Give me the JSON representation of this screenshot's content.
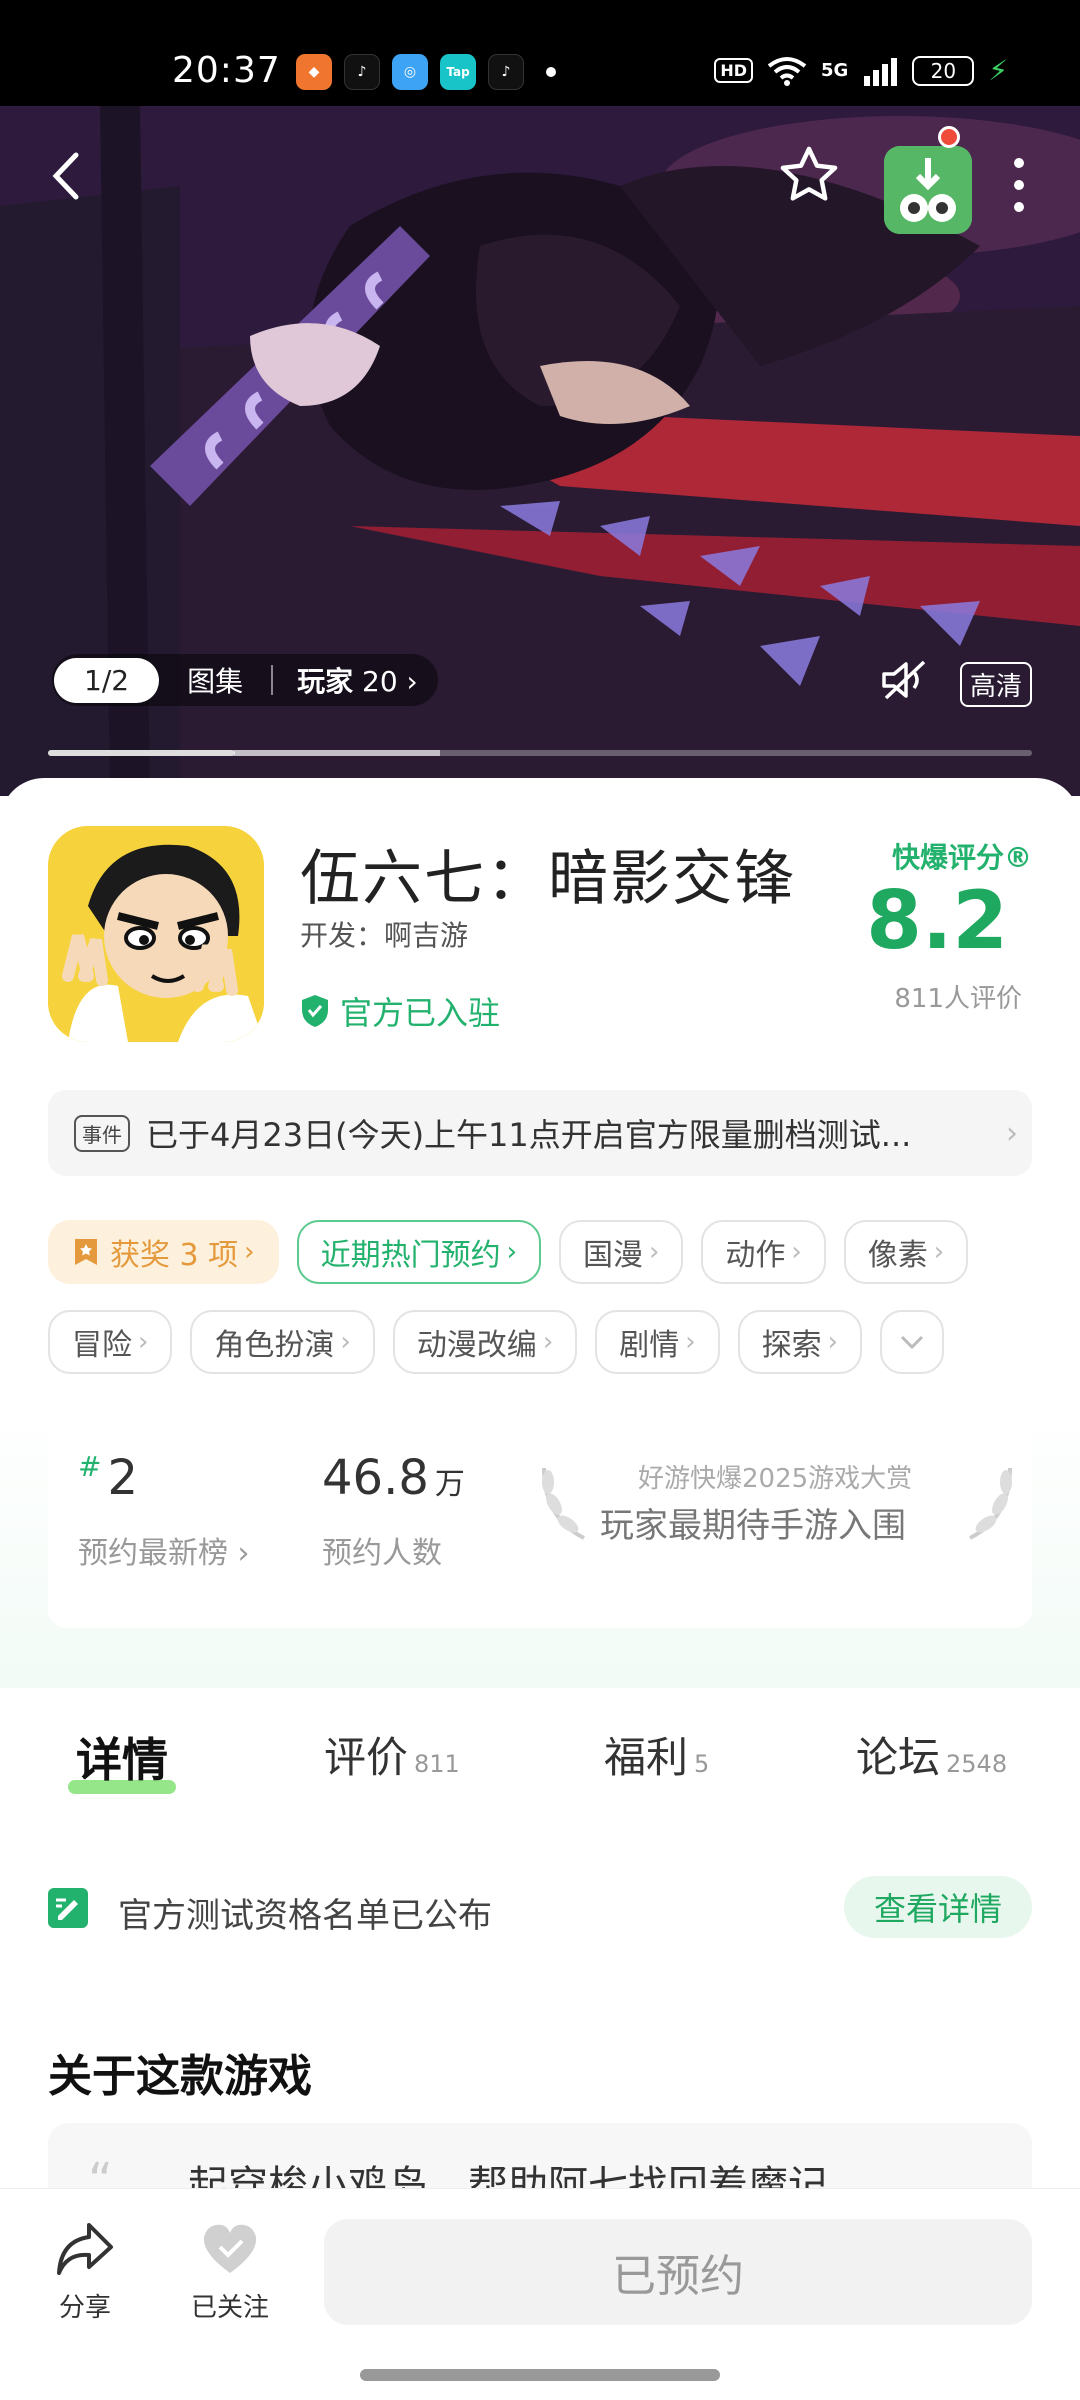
{
  "status": {
    "time": "20:37",
    "app_icons": [
      "TikTok",
      "Tap",
      "TikTok"
    ],
    "hd": "HD",
    "network": "5G",
    "battery": "20"
  },
  "hero": {
    "gallery_index": "1/2",
    "gallery_label": "图集",
    "players_label": "玩家",
    "players_count": "20",
    "quality_label": "高清",
    "icons": [
      "back-icon",
      "star-icon",
      "download-icon",
      "more-icon",
      "mute-icon"
    ],
    "progress_value": 0.19
  },
  "game": {
    "title": "伍六七：暗影交锋",
    "developer": "开发：啊吉游",
    "official_badge": "官方已入驻",
    "rating_label": "快爆评分®",
    "rating": "8.2",
    "rating_count": "811人评价"
  },
  "event": {
    "tag": "事件",
    "text": "已于4月23日(今天)上午11点开启官方限量删档测试..."
  },
  "tags_row1": [
    {
      "label": "获奖 3 项",
      "style": "award"
    },
    {
      "label": "近期热门预约",
      "style": "hot"
    },
    {
      "label": "国漫",
      "style": "normal"
    },
    {
      "label": "动作",
      "style": "normal"
    },
    {
      "label": "像素",
      "style": "normal"
    }
  ],
  "tags_row2": [
    {
      "label": "冒险"
    },
    {
      "label": "角色扮演"
    },
    {
      "label": "动漫改编"
    },
    {
      "label": "剧情"
    },
    {
      "label": "探索"
    }
  ],
  "stats": {
    "rank_hash": "#",
    "rank": "2",
    "rank_label": "预约最新榜",
    "reservations": "46.8",
    "reservations_unit": "万",
    "reservations_label": "预约人数",
    "award_sub": "好游快爆2025游戏大赏",
    "award_main": "玩家最期待手游入围"
  },
  "tabs": [
    {
      "label": "详情",
      "count": ""
    },
    {
      "label": "评价",
      "count": "811"
    },
    {
      "label": "福利",
      "count": "5"
    },
    {
      "label": "论坛",
      "count": "2548"
    }
  ],
  "notice": {
    "text": "官方测试资格名单已公布",
    "button": "查看详情"
  },
  "about": {
    "title": "关于这款游戏",
    "text": "起穿梭小鸡岛，帮助阿七找回着魔记"
  },
  "bottom": {
    "share": "分享",
    "follow": "已关注",
    "reserve": "已预约"
  },
  "colors": {
    "accent_green": "#23b26d",
    "award_orange": "#e49a3c"
  }
}
